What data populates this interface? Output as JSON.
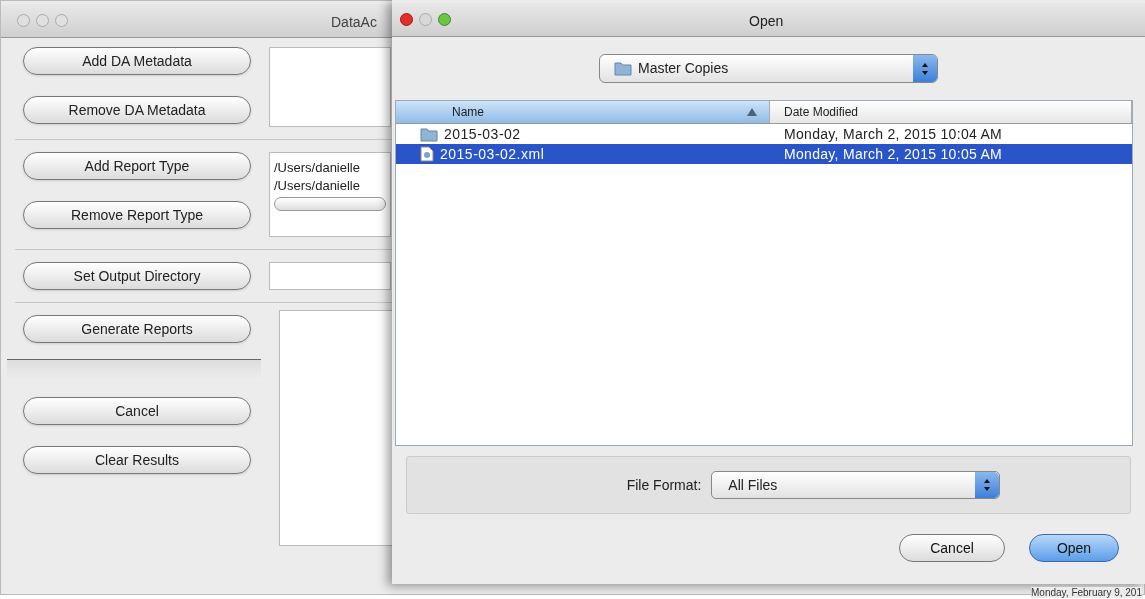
{
  "main_window": {
    "title": "DataAc",
    "buttons": [
      "Add DA Metadata",
      "Remove DA Metadata",
      "Add Report Type",
      "Remove Report Type",
      "Set Output Directory",
      "Generate Reports",
      "Cancel",
      "Clear Results"
    ],
    "report_paths": [
      "/Users/danielle",
      "/Users/danielle"
    ],
    "status_text": "Monday, February 9, 201"
  },
  "dialog": {
    "title": "Open",
    "location": "Master Copies",
    "columns": [
      {
        "label": "Name",
        "sorted": true
      },
      {
        "label": "Date Modified",
        "sorted": false
      }
    ],
    "rows": [
      {
        "kind": "folder",
        "name": "2015-03-02",
        "date": "Monday, March 2, 2015 10:04 AM",
        "selected": false
      },
      {
        "kind": "file",
        "name": "2015-03-02.xml",
        "date": "Monday, March 2, 2015 10:05 AM",
        "selected": true
      }
    ],
    "format_label": "File Format:",
    "format_value": "All Files",
    "buttons": [
      {
        "label": "Cancel",
        "default": false
      },
      {
        "label": "Open",
        "default": true
      }
    ]
  }
}
